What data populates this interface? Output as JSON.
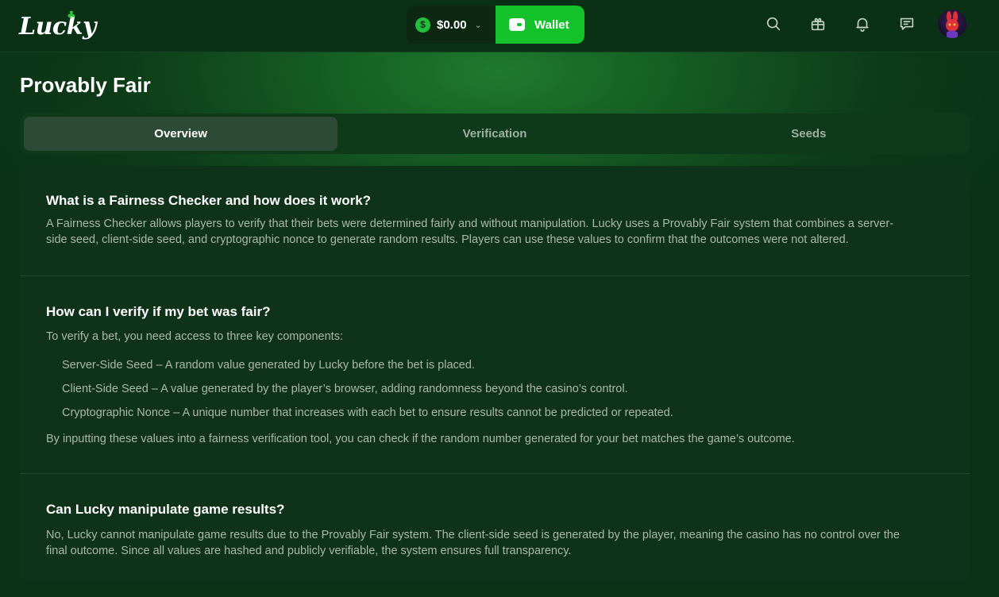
{
  "header": {
    "logo_text": "Lucky",
    "balance": "$0.00",
    "wallet_label": "Wallet",
    "colors": {
      "accent": "#13c22b",
      "background": "#0c3617"
    }
  },
  "page": {
    "title": "Provably Fair"
  },
  "tabs": [
    {
      "label": "Overview",
      "active": true
    },
    {
      "label": "Verification",
      "active": false
    },
    {
      "label": "Seeds",
      "active": false
    }
  ],
  "faq": [
    {
      "question": "What is a Fairness Checker and how does it work?",
      "answer_line1": "A Fairness Checker allows players to verify that their bets were determined fairly and without manipulation. Lucky uses a Provably Fair system that combines a server-",
      "answer_line2": "side seed, client-side seed, and cryptographic nonce to generate random results. Players can use these values to confirm that the outcomes were not altered."
    },
    {
      "question": "How can I verify if my bet was fair?",
      "intro": "To verify a bet, you need access to three key components:",
      "items": [
        "Server-Side Seed – A random value generated by Lucky before the bet is placed.",
        "Client-Side Seed – A value generated by the player’s browser, adding randomness beyond the casino’s control.",
        "Cryptographic Nonce – A unique number that increases with each bet to ensure results cannot be predicted or repeated."
      ],
      "outro": "By inputting these values into a fairness verification tool, you can check if the random number generated for your bet matches the game’s outcome."
    },
    {
      "question": "Can Lucky manipulate game results?",
      "answer_line1": "No, Lucky cannot manipulate game results due to the Provably Fair system. The client-side seed is generated by the player, meaning the casino has no control over the",
      "answer_line2": "final outcome. Since all values are hashed and publicly verifiable, the system ensures full transparency."
    }
  ]
}
